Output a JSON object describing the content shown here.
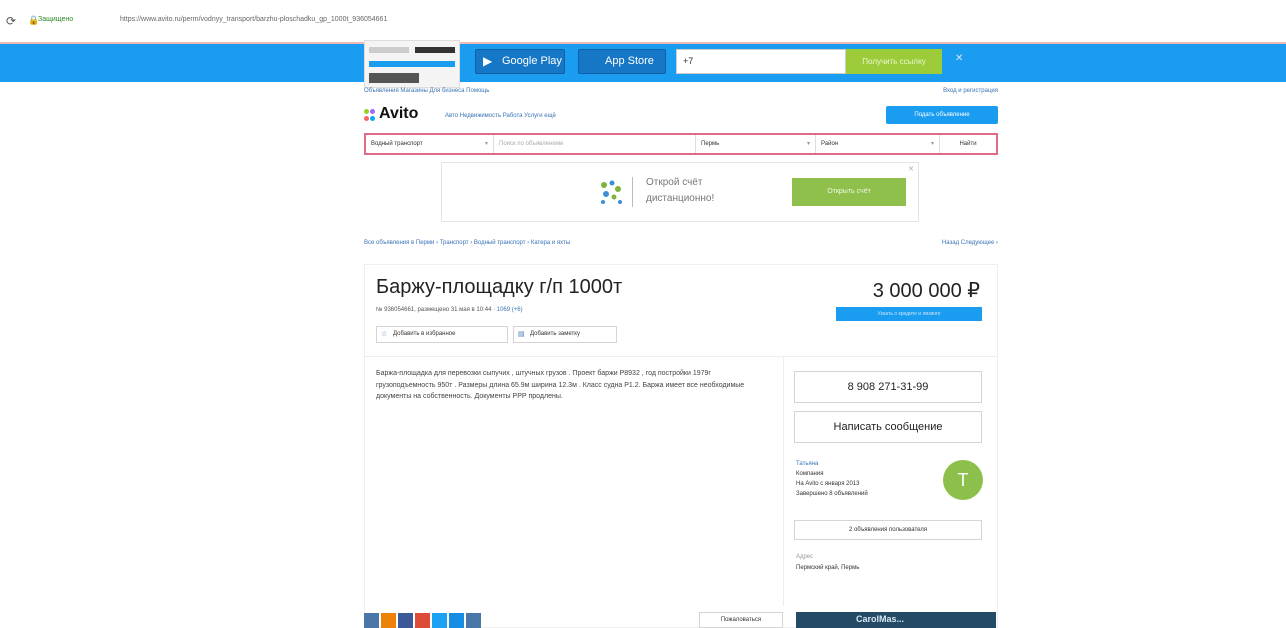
{
  "browser": {
    "secure_label": "Защищено",
    "url": "https://www.avito.ru/perm/vodnyy_transport/barzhu-ploschadku_gp_1000t_936054661"
  },
  "banner": {
    "google_play": "Google Play",
    "app_store": "App Store",
    "phone_input": "+7",
    "submit": "Получить ссылку",
    "close": "✕"
  },
  "toplinks": {
    "left": "Объявления   Магазины   Для бизнеса   Помощь",
    "right": "Вход и регистрация"
  },
  "header": {
    "logo": "Avito",
    "categories": "Авто   Недвижимость   Работа   Услуги   ещё",
    "post_ad": "Подать объявление"
  },
  "search": {
    "category": "Водный транспорт",
    "query_placeholder": "Поиск по объявлениям",
    "city": "Пермь",
    "district": "Район",
    "button": "Найти"
  },
  "ad": {
    "line1": "Открой счёт",
    "line2": "дистанционно!",
    "button": "Открыть счёт",
    "close": "✕"
  },
  "breadcrumbs": {
    "path": "Все объявления в Перми › Транспорт › Водный транспорт › Катера и яхты",
    "right": "Назад   Следующее ›"
  },
  "listing": {
    "title": "Баржу-площадку г/п 1000т",
    "meta": "№ 936054661, размещено 31 мая в 10:44",
    "views": "1069 (+6)",
    "price": "3 000 000 ₽",
    "price_bar": "Узнать о кредите и лизинге",
    "favorite": "Добавить в избранное",
    "note": "Добавить заметку",
    "description": "Баржа-площадка для перевозки сыпучих , штучных грузов . Проект баржи Р8932 , год постройки 1979г грузоподъемность 950т . Размеры длина 65.9м ширина 12.3м . Класс судна Р1.2. Баржа имеет все необходимые документы на собственность. Документы РРР продлены."
  },
  "seller": {
    "phone": "8 908 271-31-99",
    "message": "Написать сообщение",
    "name": "Татьяна",
    "role": "Компания",
    "since": "На Avito с января 2013",
    "completed": "Завершено 8 объявлений",
    "more_ads": "2 объявления пользователя",
    "address_label": "Адрес",
    "address": "Пермский край, Пермь",
    "avatar_letter": "Т"
  },
  "footer": {
    "complain": "Пожаловаться",
    "adbox_text": "CarolMas..."
  },
  "colors": {
    "banner_blue": "#1a9cf0",
    "search_border": "#e06b86",
    "ad_green": "#8fc04b",
    "avatar_green": "#8cc04a"
  }
}
